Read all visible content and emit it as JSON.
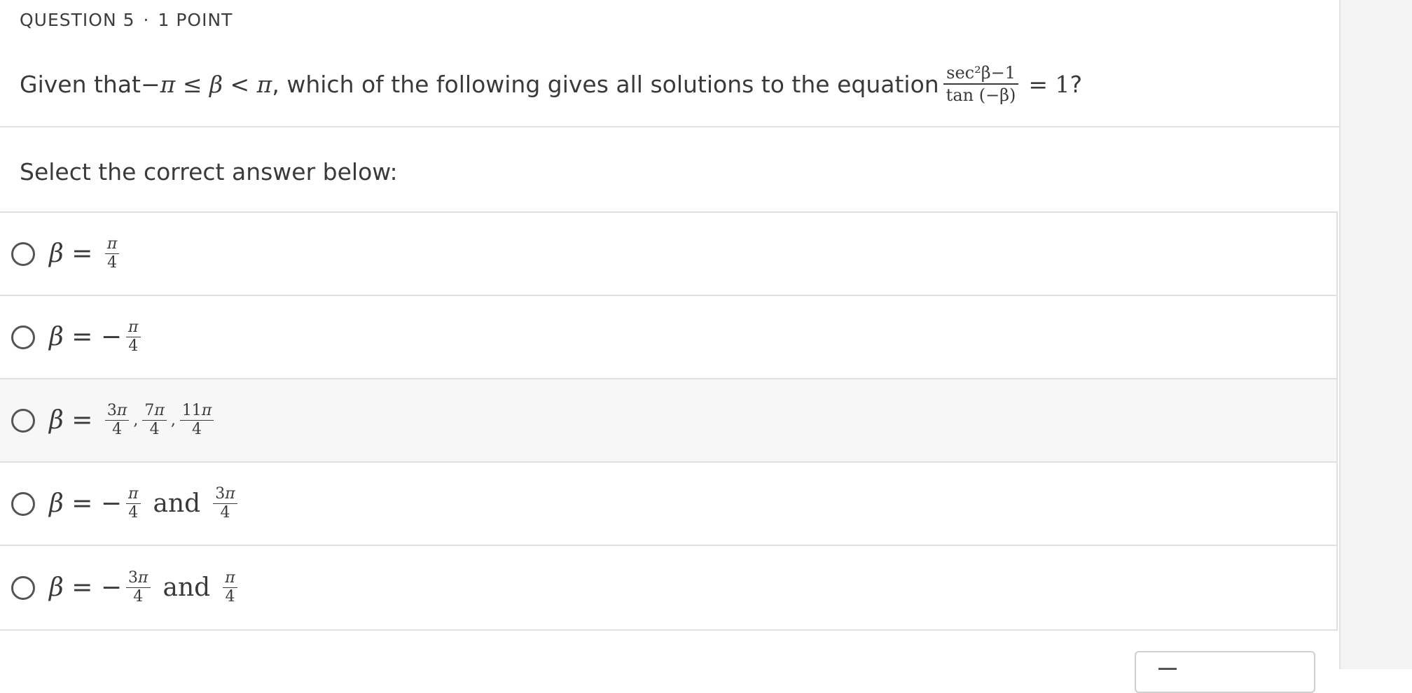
{
  "question": {
    "number_label": "QUESTION 5",
    "separator": "·",
    "points_label": "1 POINT",
    "text_before": "Given that ",
    "condition": "−π ≤ β < π",
    "text_after": ", which of the following gives all solutions to the equation ",
    "equation": {
      "numerator": "sec²β−1",
      "denominator": "tan (−β)",
      "rhs": "= 1",
      "trailing": "?"
    }
  },
  "prompt": "Select the correct answer below:",
  "options": [
    {
      "label": "β = π/4",
      "selected": false
    },
    {
      "label": "β = −π/4",
      "selected": false
    },
    {
      "label": "β = 3π/4, 7π/4, 11π/4",
      "selected": false,
      "hovered": true
    },
    {
      "label": "β = −π/4 and 3π/4",
      "selected": false
    },
    {
      "label": "β = −3π/4 and π/4",
      "selected": false
    }
  ],
  "colors": {
    "text": "#3a3a3a",
    "border": "#e0e0e0",
    "hover_row": "#f7f7f7",
    "right_strip": "#f3f3f3"
  }
}
